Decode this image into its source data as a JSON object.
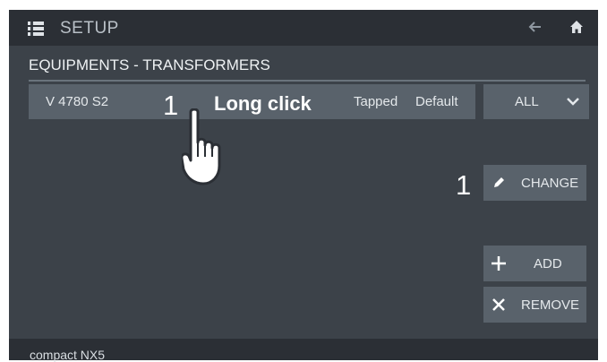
{
  "header": {
    "title": "SETUP",
    "menu_icon": "list-icon",
    "back_icon": "arrow-left-icon",
    "home_icon": "home-icon"
  },
  "section": {
    "title": "EQUIPMENTS - TRANSFORMERS"
  },
  "table": {
    "rows": [
      {
        "name": "V 4780 S2",
        "tapped": "Tapped",
        "default": "Default"
      }
    ]
  },
  "filter": {
    "selected": "ALL"
  },
  "annotations": {
    "step1": "1",
    "long_click": "Long click",
    "step2": "1"
  },
  "buttons": {
    "change": "CHANGE",
    "add": "ADD",
    "remove": "REMOVE"
  },
  "footer": {
    "device": "compact NX5"
  },
  "colors": {
    "background": "#3c4249",
    "bar": "#2b2f35",
    "control": "#59626b",
    "text": "#e4e8eb"
  }
}
